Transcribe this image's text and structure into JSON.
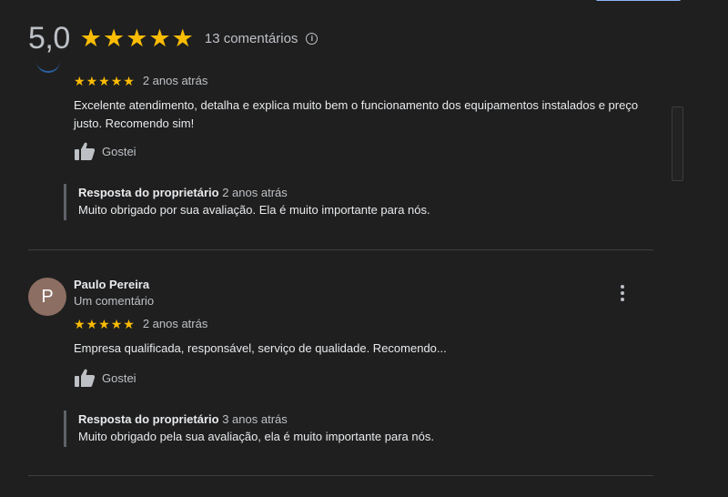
{
  "summary": {
    "rating": "5,0",
    "stars": 5,
    "comment_count": "13 comentários",
    "star_color": "#fbbc04"
  },
  "reviews": [
    {
      "author": "",
      "author_meta": "",
      "rating_stars": 5,
      "time_ago": "2 anos atrás",
      "text": "Excelente atendimento, detalha e explica muito bem o funcionamento dos equipamentos instalados e preço justo. Recomendo sim!",
      "like_label": "Gostei",
      "owner_reply": {
        "title": "Resposta do proprietário",
        "time_ago": "2 anos atrás",
        "text": "Muito obrigado por sua avaliação. Ela é muito importante para nós."
      }
    },
    {
      "author": "Paulo Pereira",
      "author_initial": "P",
      "author_meta": "Um comentário",
      "avatar_color": "#8d6e63",
      "rating_stars": 5,
      "time_ago": "2 anos atrás",
      "text": "Empresa  qualificada, responsável,  serviço de qualidade. Recomendo...",
      "like_label": "Gostei",
      "owner_reply": {
        "title": "Resposta do proprietário",
        "time_ago": "3 anos atrás",
        "text": "Muito obrigado pela sua avaliação, ela é muito importante para nós."
      }
    }
  ],
  "icons": {
    "star": "star-icon",
    "info": "info-icon",
    "like": "thumbs-up-icon",
    "more": "more-vert-icon"
  }
}
